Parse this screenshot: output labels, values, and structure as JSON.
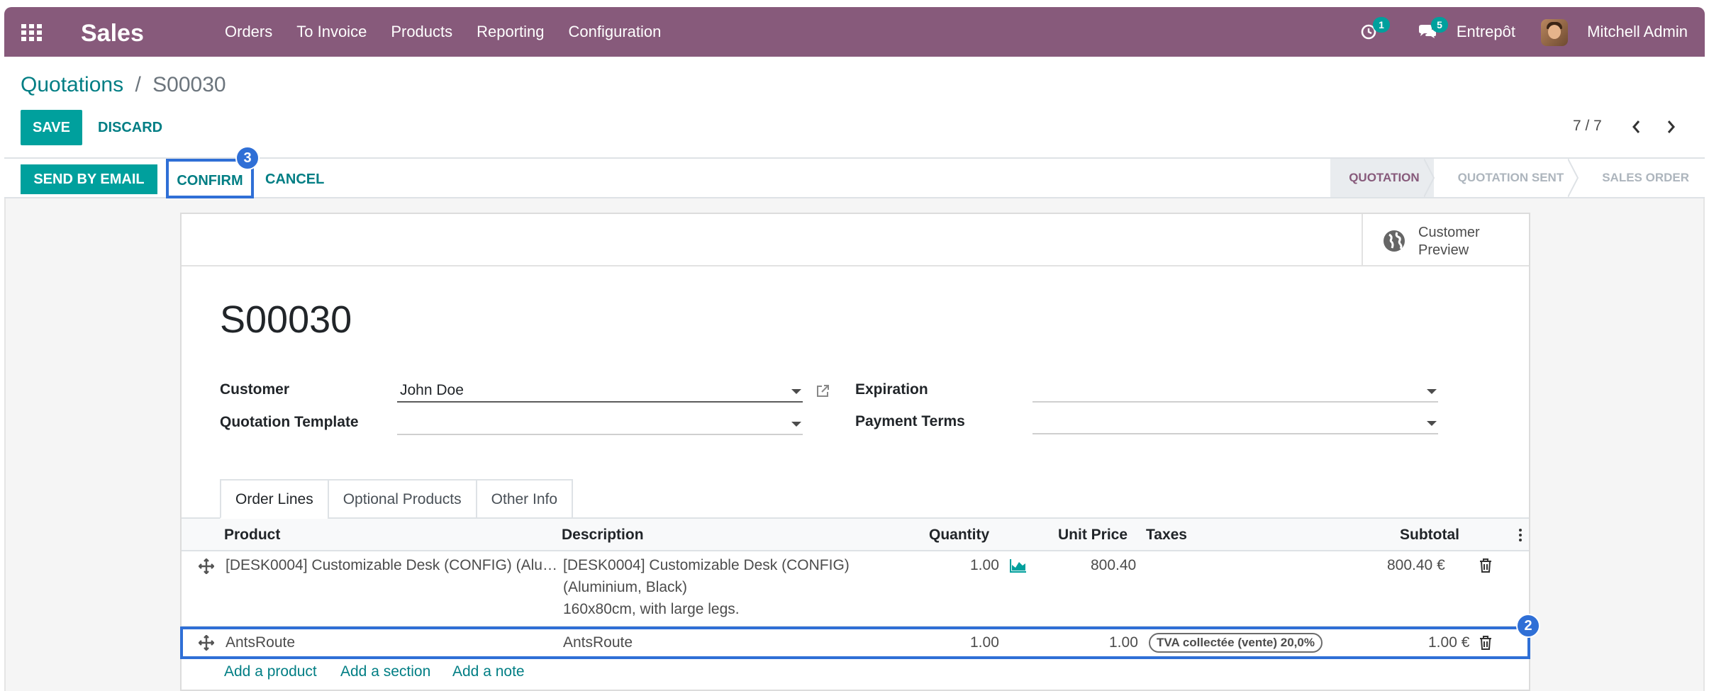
{
  "navbar": {
    "app_name": "Sales",
    "menu": [
      "Orders",
      "To Invoice",
      "Products",
      "Reporting",
      "Configuration"
    ],
    "activity_count": "1",
    "message_count": "5",
    "company": "Entrepôt",
    "user": "Mitchell Admin"
  },
  "breadcrumb": {
    "parent": "Quotations",
    "separator": "/",
    "current": "S00030"
  },
  "actions": {
    "save": "SAVE",
    "discard": "DISCARD"
  },
  "pager": {
    "value": "7 / 7"
  },
  "statusbar": {
    "send_by_email": "SEND BY EMAIL",
    "confirm": "CONFIRM",
    "cancel": "CANCEL",
    "stages": [
      "QUOTATION",
      "QUOTATION SENT",
      "SALES ORDER"
    ],
    "active_stage": "QUOTATION"
  },
  "annotations": {
    "confirm_step": "3",
    "row_step": "2",
    "color": "#2f6fd6"
  },
  "smart_button": {
    "line1": "Customer",
    "line2": "Preview"
  },
  "form": {
    "title": "S00030",
    "customer_label": "Customer",
    "customer_value": "John Doe",
    "template_label": "Quotation Template",
    "template_value": "",
    "expiration_label": "Expiration",
    "expiration_value": "",
    "payment_terms_label": "Payment Terms",
    "payment_terms_value": ""
  },
  "tabs": [
    "Order Lines",
    "Optional Products",
    "Other Info"
  ],
  "order_lines": {
    "columns": {
      "product": "Product",
      "description": "Description",
      "quantity": "Quantity",
      "unit_price": "Unit Price",
      "taxes": "Taxes",
      "subtotal": "Subtotal"
    },
    "rows": [
      {
        "product": "[DESK0004] Customizable Desk (CONFIG) (Alu…",
        "description_lines": [
          "[DESK0004] Customizable Desk (CONFIG)",
          "(Aluminium, Black)",
          "160x80cm, with large legs."
        ],
        "quantity": "1.00",
        "unit_price": "800.40",
        "taxes": "",
        "subtotal": "800.40 €"
      },
      {
        "product": "AntsRoute",
        "description_lines": [
          "AntsRoute"
        ],
        "quantity": "1.00",
        "unit_price": "1.00",
        "taxes": "TVA collectée (vente) 20,0%",
        "subtotal": "1.00 €"
      }
    ],
    "add_product": "Add a product",
    "add_section": "Add a section",
    "add_note": "Add a note"
  },
  "colors": {
    "brand": "#875a7b",
    "accent": "#00a09d",
    "link": "#017e84"
  }
}
